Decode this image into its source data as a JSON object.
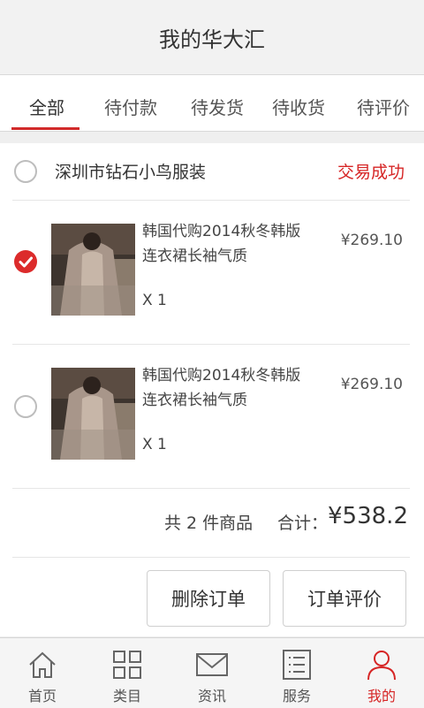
{
  "header": {
    "title": "我的华大汇"
  },
  "tabs": [
    {
      "label": "全部",
      "active": true
    },
    {
      "label": "待付款"
    },
    {
      "label": "待发货"
    },
    {
      "label": "待收货"
    },
    {
      "label": "待评价"
    }
  ],
  "order": {
    "shop_name": "深圳市钻石小鸟服装",
    "status": "交易成功",
    "items": [
      {
        "title": "韩国代购2014秋冬韩版连衣裙长袖气质",
        "qty": "X 1",
        "price": "¥269.10",
        "selected": true
      },
      {
        "title": "韩国代购2014秋冬韩版连衣裙长袖气质",
        "qty": "X 1",
        "price": "¥269.10",
        "selected": false
      }
    ],
    "summary": {
      "count": "共 2 件商品",
      "total_label": "合计：",
      "total": "¥538.2"
    },
    "buttons": {
      "delete": "删除订单",
      "review": "订单评价"
    }
  },
  "bottom_nav": [
    {
      "label": "首页",
      "icon": "home-icon"
    },
    {
      "label": "类目",
      "icon": "grid-icon"
    },
    {
      "label": "资讯",
      "icon": "mail-icon"
    },
    {
      "label": "服务",
      "icon": "list-icon"
    },
    {
      "label": "我的",
      "icon": "user-icon",
      "active": true
    }
  ],
  "colors": {
    "accent": "#d62525",
    "checked": "#dc2b2b"
  }
}
